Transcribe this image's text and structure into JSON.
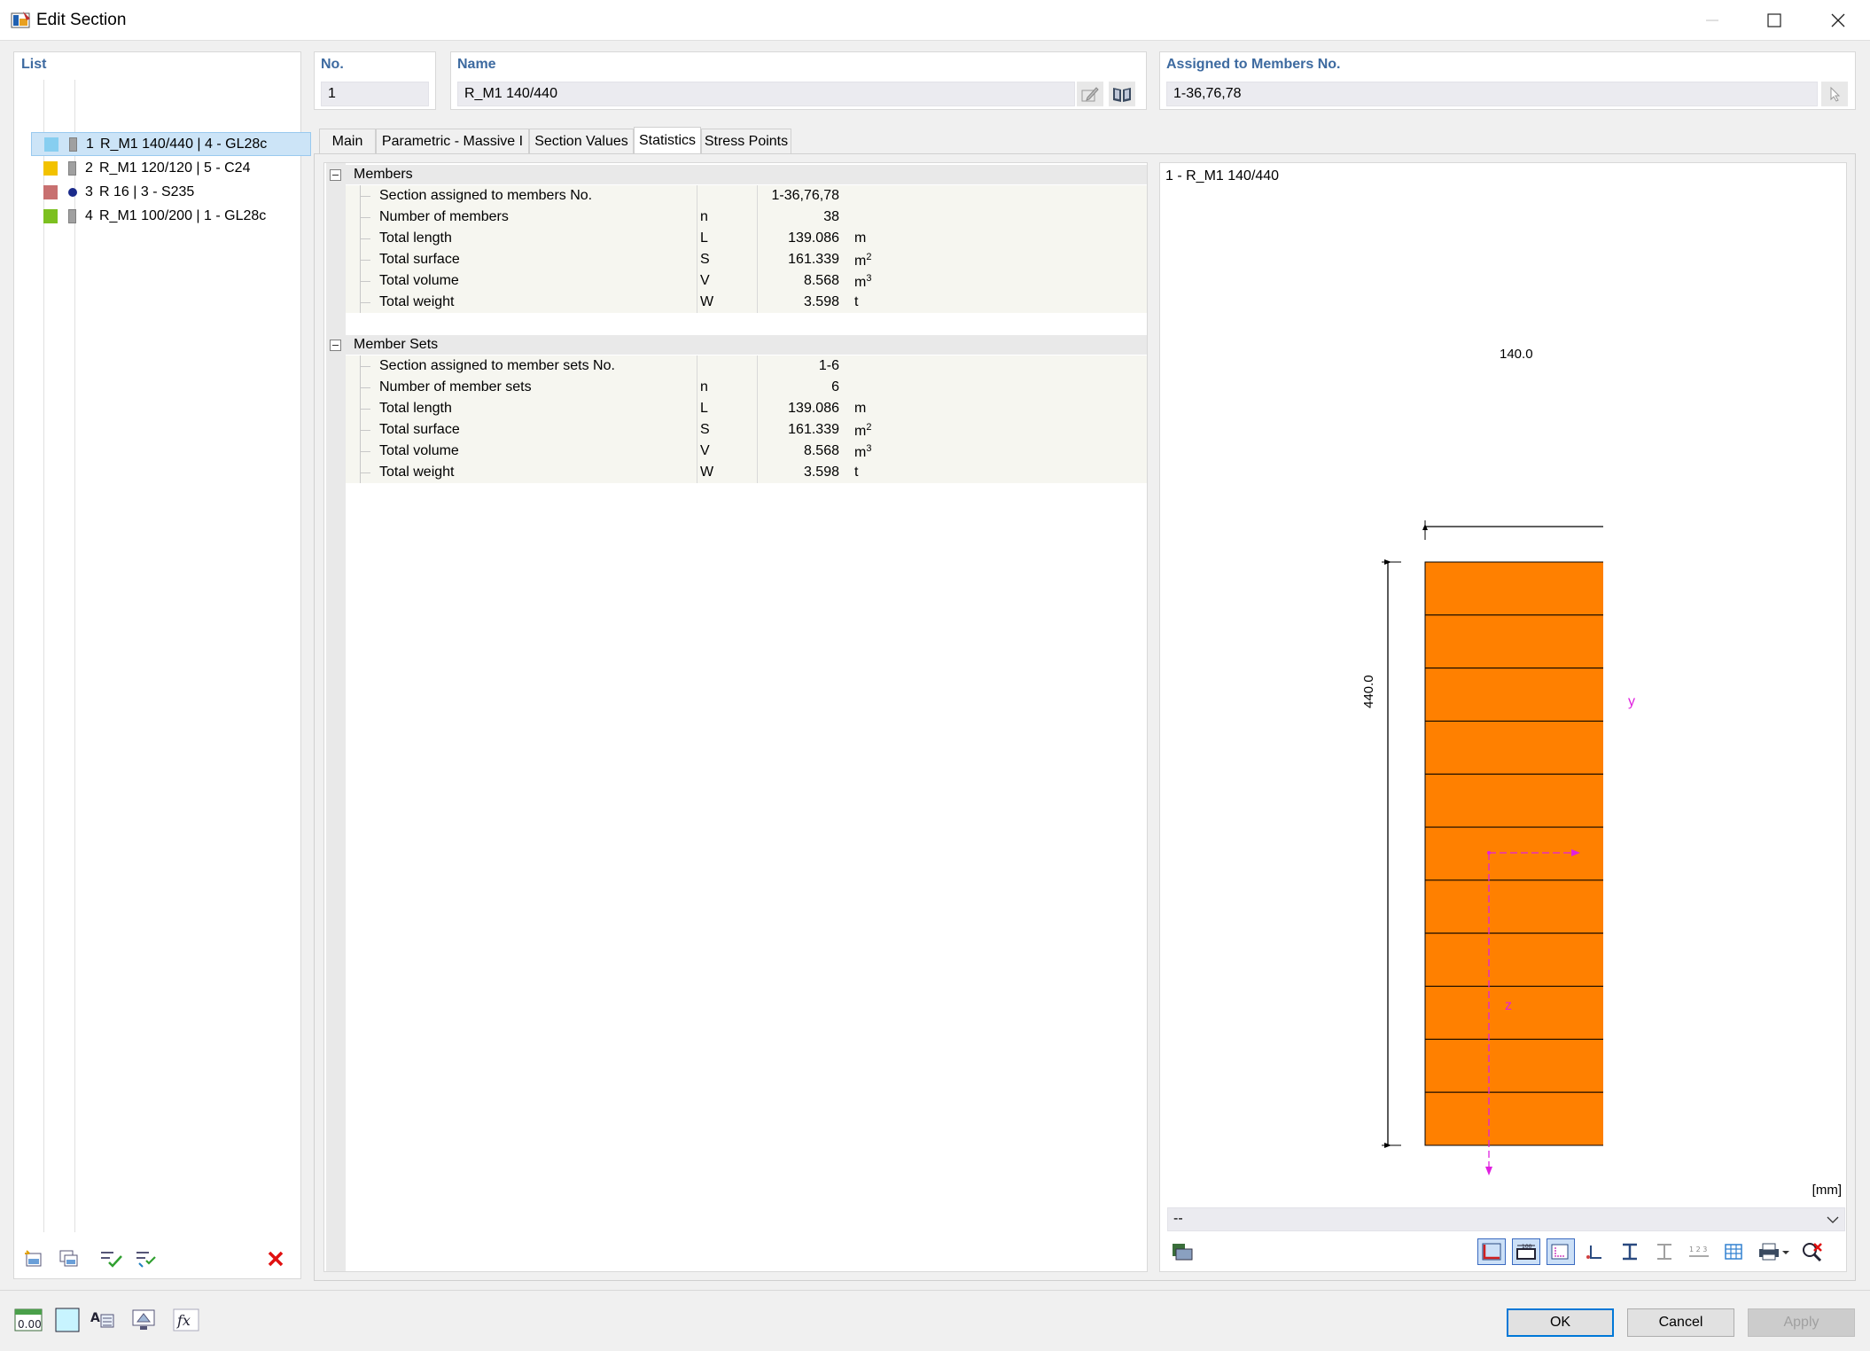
{
  "window": {
    "title": "Edit Section"
  },
  "list": {
    "header": "List",
    "items": [
      {
        "num": "1",
        "label": "R_M1 140/440 | 4 - GL28c",
        "color": "#87cef0",
        "marker": "rect",
        "selected": true
      },
      {
        "num": "2",
        "label": "R_M1 120/120 | 5 - C24",
        "color": "#f2c200",
        "marker": "rect",
        "selected": false
      },
      {
        "num": "3",
        "label": "R 16 | 3 - S235",
        "color": "#c87070",
        "marker": "dot",
        "selected": false
      },
      {
        "num": "4",
        "label": "R_M1 100/200 | 1 - GL28c",
        "color": "#7cc020",
        "marker": "rect",
        "selected": false
      }
    ]
  },
  "no": {
    "label": "No.",
    "value": "1"
  },
  "name": {
    "label": "Name",
    "value": "R_M1 140/440"
  },
  "assigned": {
    "label": "Assigned to Members No.",
    "value": "1-36,76,78"
  },
  "tabs": [
    {
      "label": "Main"
    },
    {
      "label": "Parametric - Massive I"
    },
    {
      "label": "Section Values"
    },
    {
      "label": "Statistics",
      "active": true
    },
    {
      "label": "Stress Points"
    }
  ],
  "stats": {
    "members": {
      "title": "Members",
      "rows": [
        {
          "name": "Section assigned to members No.",
          "sym": "",
          "val": "1-36,76,78",
          "unit": "",
          "sup": ""
        },
        {
          "name": "Number of members",
          "sym": "n",
          "val": "38",
          "unit": "",
          "sup": ""
        },
        {
          "name": "Total length",
          "sym": "L",
          "val": "139.086",
          "unit": "m",
          "sup": ""
        },
        {
          "name": "Total surface",
          "sym": "S",
          "val": "161.339",
          "unit": "m",
          "sup": "2"
        },
        {
          "name": "Total volume",
          "sym": "V",
          "val": "8.568",
          "unit": "m",
          "sup": "3"
        },
        {
          "name": "Total weight",
          "sym": "W",
          "val": "3.598",
          "unit": "t",
          "sup": ""
        }
      ]
    },
    "member_sets": {
      "title": "Member Sets",
      "rows": [
        {
          "name": "Section assigned to member sets No.",
          "sym": "",
          "val": "1-6",
          "unit": "",
          "sup": ""
        },
        {
          "name": "Number of member sets",
          "sym": "n",
          "val": "6",
          "unit": "",
          "sup": ""
        },
        {
          "name": "Total length",
          "sym": "L",
          "val": "139.086",
          "unit": "m",
          "sup": ""
        },
        {
          "name": "Total surface",
          "sym": "S",
          "val": "161.339",
          "unit": "m",
          "sup": "2"
        },
        {
          "name": "Total volume",
          "sym": "V",
          "val": "8.568",
          "unit": "m",
          "sup": "3"
        },
        {
          "name": "Total weight",
          "sym": "W",
          "val": "3.598",
          "unit": "t",
          "sup": ""
        }
      ]
    }
  },
  "preview": {
    "title": "1 - R_M1 140/440",
    "dim_width": "140.0",
    "dim_height": "440.0",
    "axis_y": "y",
    "axis_z": "z",
    "units": "[mm]",
    "combo_value": "--",
    "fill_color": "#ff8000",
    "layers": 11
  },
  "buttons": {
    "ok": "OK",
    "cancel": "Cancel",
    "apply": "Apply"
  },
  "bottom_icons": {
    "value_display": "0.00"
  }
}
